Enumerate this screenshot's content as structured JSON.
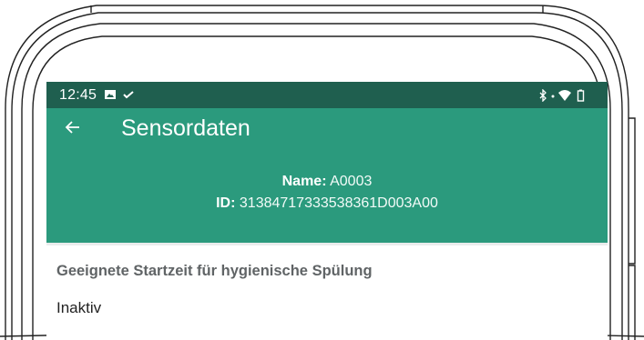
{
  "status_bar": {
    "time": "12:45",
    "notification_icons": [
      "image-icon",
      "check-icon"
    ],
    "system_icons": [
      "bluetooth-icon",
      "wifi-icon",
      "battery-icon"
    ]
  },
  "app_bar": {
    "back_icon": "arrow-left-icon",
    "title": "Sensordaten"
  },
  "sensor": {
    "name_label": "Name:",
    "name_value": "A0003",
    "id_label": "ID:",
    "id_value": "31384717333538361D003A00"
  },
  "setting": {
    "title": "Geeignete Startzeit für hygienische Spülung",
    "value": "Inaktiv"
  },
  "colors": {
    "status_bar": "#1f5f4f",
    "app_bar": "#2b9a7d",
    "setting_title": "#606466"
  }
}
